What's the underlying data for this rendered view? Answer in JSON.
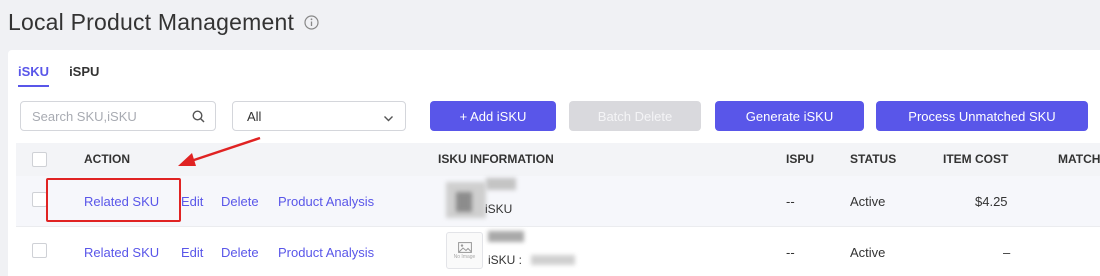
{
  "page": {
    "title": "Local Product Management"
  },
  "tabs": [
    {
      "label": "iSKU",
      "active": true
    },
    {
      "label": "iSPU",
      "active": false
    }
  ],
  "toolbar": {
    "search_placeholder": "Search SKU,iSKU",
    "filter_value": "All",
    "add_label": "+ Add iSKU",
    "batch_delete_label": "Batch Delete",
    "generate_label": "Generate iSKU",
    "process_label": "Process Unmatched SKU"
  },
  "table": {
    "columns": [
      "ACTION",
      "ISKU INFORMATION",
      "ISPU",
      "STATUS",
      "ITEM COST",
      "MATCH"
    ],
    "actions": [
      "Related SKU",
      "Edit",
      "Delete",
      "Product Analysis"
    ],
    "rows": [
      {
        "isku_text": "iSKU",
        "ispu": "--",
        "status": "Active",
        "item_cost": "$4.25"
      },
      {
        "isku_text": "iSKU :",
        "thumb_caption": "No Image",
        "ispu": "--",
        "status": "Active",
        "item_cost": "–"
      }
    ]
  },
  "colors": {
    "accent": "#5956e9",
    "annotation": "#e02323",
    "disabled": "#d9d9dd"
  }
}
